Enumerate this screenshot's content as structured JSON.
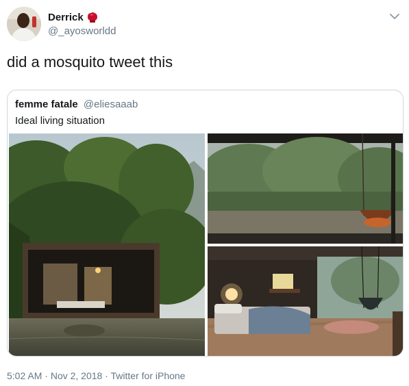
{
  "author": {
    "display_name": "Derrick",
    "handle": "@_ayosworldd",
    "name_emoji": "boxing-glove-emoji"
  },
  "tweet": {
    "text": "did a mosquito tweet this"
  },
  "quoted_tweet": {
    "display_name": "femme fatale",
    "handle": "@eliesaaab",
    "text": "Ideal living situation",
    "images": [
      {
        "name": "jungle-cabin-on-river-photo"
      },
      {
        "name": "river-view-with-hanging-chair-photo"
      },
      {
        "name": "cabin-bedroom-interior-photo"
      }
    ]
  },
  "meta": {
    "time": "5:02 AM",
    "separator": "·",
    "date": "Nov 2, 2018",
    "source": "Twitter for iPhone"
  },
  "colors": {
    "text_primary": "#14171a",
    "text_secondary": "#657786",
    "border": "#ccd6dd",
    "emoji_red": "#c8102e"
  },
  "icons": {
    "more": "chevron-down-icon"
  }
}
